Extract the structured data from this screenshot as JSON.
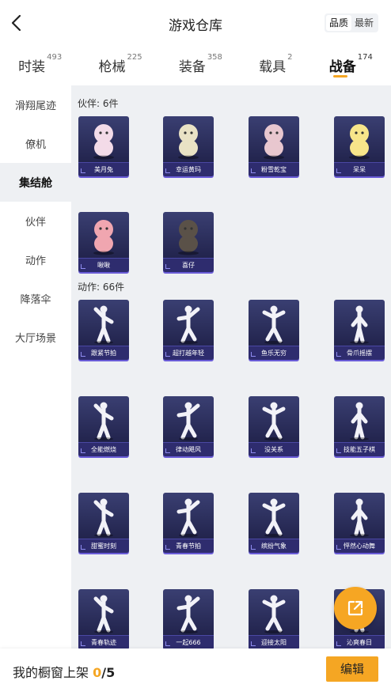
{
  "header": {
    "title": "游戏仓库",
    "sort_options": [
      "品质",
      "最新"
    ],
    "sort_selected": "品质"
  },
  "tabs": [
    {
      "label": "时装",
      "count": "493"
    },
    {
      "label": "枪械",
      "count": "225"
    },
    {
      "label": "装备",
      "count": "358"
    },
    {
      "label": "载具",
      "count": "2"
    },
    {
      "label": "战备",
      "count": "174",
      "active": true
    }
  ],
  "sidebar": {
    "items": [
      "滑翔尾迹",
      "僚机",
      "集结舱",
      "伙伴",
      "动作",
      "降落伞",
      "大厅场景"
    ],
    "active": "集结舱"
  },
  "sections": {
    "partners": {
      "title": "伙伴: 6件",
      "items": [
        "美月兔",
        "幸运黄玛",
        "粉雪乾宝",
        "呆呆",
        "啾啾",
        "喜仔"
      ]
    },
    "actions": {
      "title": "动作: 66件",
      "items": [
        "跟紧节拍",
        "超打越年轻",
        "鱼乐无穷",
        "骨爪摇摆",
        "全能燃烧",
        "律动飓风",
        "没关系",
        "技能五子棋",
        "甜蜜时刻",
        "青春节拍",
        "缤纷气象",
        "怦然心动舞",
        "青春轨迹",
        "一起666",
        "迎接太阳",
        "沁爽春日"
      ]
    }
  },
  "footer": {
    "label": "我的橱窗上架",
    "current": "0",
    "total": "/5",
    "edit_label": "编辑"
  },
  "colors": {
    "accent": "#f5a623",
    "card_bg": "#242650",
    "content_bg": "#eef0f3"
  }
}
